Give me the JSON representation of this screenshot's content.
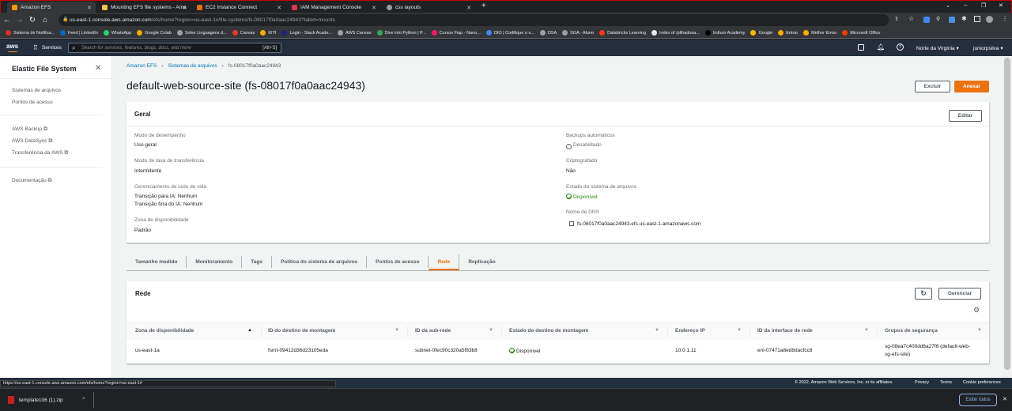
{
  "browser": {
    "tabs": [
      {
        "label": "Amazon EFS",
        "color": "#ff9900"
      },
      {
        "label": "Mounting EFS file systems - Ama",
        "color": "#f5c34a"
      },
      {
        "label": "EC2 Instance Connect",
        "color": "#e8730c"
      },
      {
        "label": "IAM Management Console",
        "color": "#dd344c"
      },
      {
        "label": "css layouts",
        "color": "#9aa0a6"
      }
    ],
    "url_host": "us-east-1.console.aws.amazon.com",
    "url_path": "/efs/home?region=us-east-1#/file-systems/fs-08017f0a0aac24943?tabId=mounts",
    "bookmarks": [
      {
        "label": "Sistema de Notifica...",
        "color": "#d93025"
      },
      {
        "label": "Feed | LinkedIn",
        "color": "#0a66c2"
      },
      {
        "label": "WhatsApp",
        "color": "#25d366"
      },
      {
        "label": "Google Colab",
        "color": "#f9ab00"
      },
      {
        "label": "Solve Linguagens d...",
        "color": "#9aa0a6"
      },
      {
        "label": "Canvas",
        "color": "#e13b2b"
      },
      {
        "label": "KITI",
        "color": "#f9ab00"
      },
      {
        "label": "Login - Stack Acade...",
        "color": "#1a237e"
      },
      {
        "label": "AWS Canvas",
        "color": "#9aa0a6"
      },
      {
        "label": "Dive into Python | P...",
        "color": "#34a853"
      },
      {
        "label": "Cursos Fiap - Nano...",
        "color": "#e91e63"
      },
      {
        "label": "DIO | Codifique o s...",
        "color": "#4285f4"
      },
      {
        "label": "DSA",
        "color": "#9aa0a6"
      },
      {
        "label": "SGA - Aluno",
        "color": "#9aa0a6"
      },
      {
        "label": "Databricks Learning",
        "color": "#ff3621"
      },
      {
        "label": "Index of /pilhadosa...",
        "color": "#e8eaed"
      },
      {
        "label": "Iridium Academy",
        "color": "#000000"
      },
      {
        "label": "Google",
        "color": "#fbbc04"
      },
      {
        "label": "Entrar",
        "color": "#f9ab00"
      },
      {
        "label": "Melhor Envio",
        "color": "#f9ab00"
      },
      {
        "label": "Microsoft Office",
        "color": "#eb3c00"
      }
    ]
  },
  "awsnav": {
    "logo": "aws",
    "services": "Services",
    "search_placeholder": "Search for services, features, blogs, docs, and more",
    "search_shortcut": "[Alt+S]",
    "region": "Norte da Virgínia ▾",
    "user": "juniorpsilva ▾"
  },
  "sidebar": {
    "title": "Elastic File System",
    "items": [
      "Sistemas de arquivos",
      "Pontos de acesso",
      "AWS Backup",
      "AWS DataSync",
      "Transferência da AWS",
      "Documentação"
    ]
  },
  "breadcrumb": [
    "Amazon EFS",
    "Sistemas de arquivos",
    "fs-08017f0a0aac24943"
  ],
  "page": {
    "title": "default-web-source-site (fs-08017f0a0aac24943)",
    "delete_button": "Excluir",
    "attach_button": "Anexar"
  },
  "general": {
    "title": "Geral",
    "edit_button": "Editar",
    "perf_label": "Modo de desempenho",
    "perf_value": "Uso geral",
    "throughput_label": "Modo de taxa de transferência",
    "throughput_value": "Intermitente",
    "lifecycle_label": "Gerenciamento de ciclo de vida",
    "lifecycle_value1": "Transição para IA: Nenhum",
    "lifecycle_value2": "Transição fora do IA: Nenhum",
    "az_label": "Zona de disponibilidade",
    "az_value": "Padrão",
    "backup_label": "Backups automáticos",
    "backup_value": "Desabilitado",
    "encrypt_label": "Criptografado",
    "encrypt_value": "Não",
    "state_label": "Estado do sistema de arquivos",
    "state_value": "Disponível",
    "dns_label": "Nome de DNS",
    "dns_value": "fs-08017f0a0aac24943.efs.us-east-1.amazonaws.com"
  },
  "tabs": [
    "Tamanho medido",
    "Monitoramento",
    "Tags",
    "Política do sistema de arquivos",
    "Pontos de acesso",
    "Rede",
    "Replicação"
  ],
  "network": {
    "title": "Rede",
    "manage_button": "Gerenciar",
    "columns": [
      "Zona de disponibilidade",
      "ID do destino de montagem",
      "ID da sub-rede",
      "Estado do destino de montagem",
      "Endereço IP",
      "ID da interface de rede",
      "Grupos de segurança"
    ],
    "row": {
      "az": "us-east-1a",
      "mount_id": "fsmt-09412d36d23105eda",
      "subnet": "subnet-0fec90c320a5f83b8",
      "state": "Disponível",
      "ip": "10.0.1.11",
      "eni": "eni-07471a8ed8dacfcc8",
      "sg1": "sg-08ea7c400dd6a27f6 (default-web-",
      "sg2": "sg-efs-site)"
    }
  },
  "footer": {
    "copyright": "© 2022, Amazon Web Services, Inc. or its affiliates.",
    "privacy": "Privacy",
    "terms": "Terms",
    "cookies": "Cookie preferences"
  },
  "statusbar_url": "https://us-east-1.console.aws.amazon.com/efs/home?region=us-east-1#",
  "downloads": {
    "file": "template106 (1).zip",
    "show_all": "Exibir todos"
  }
}
